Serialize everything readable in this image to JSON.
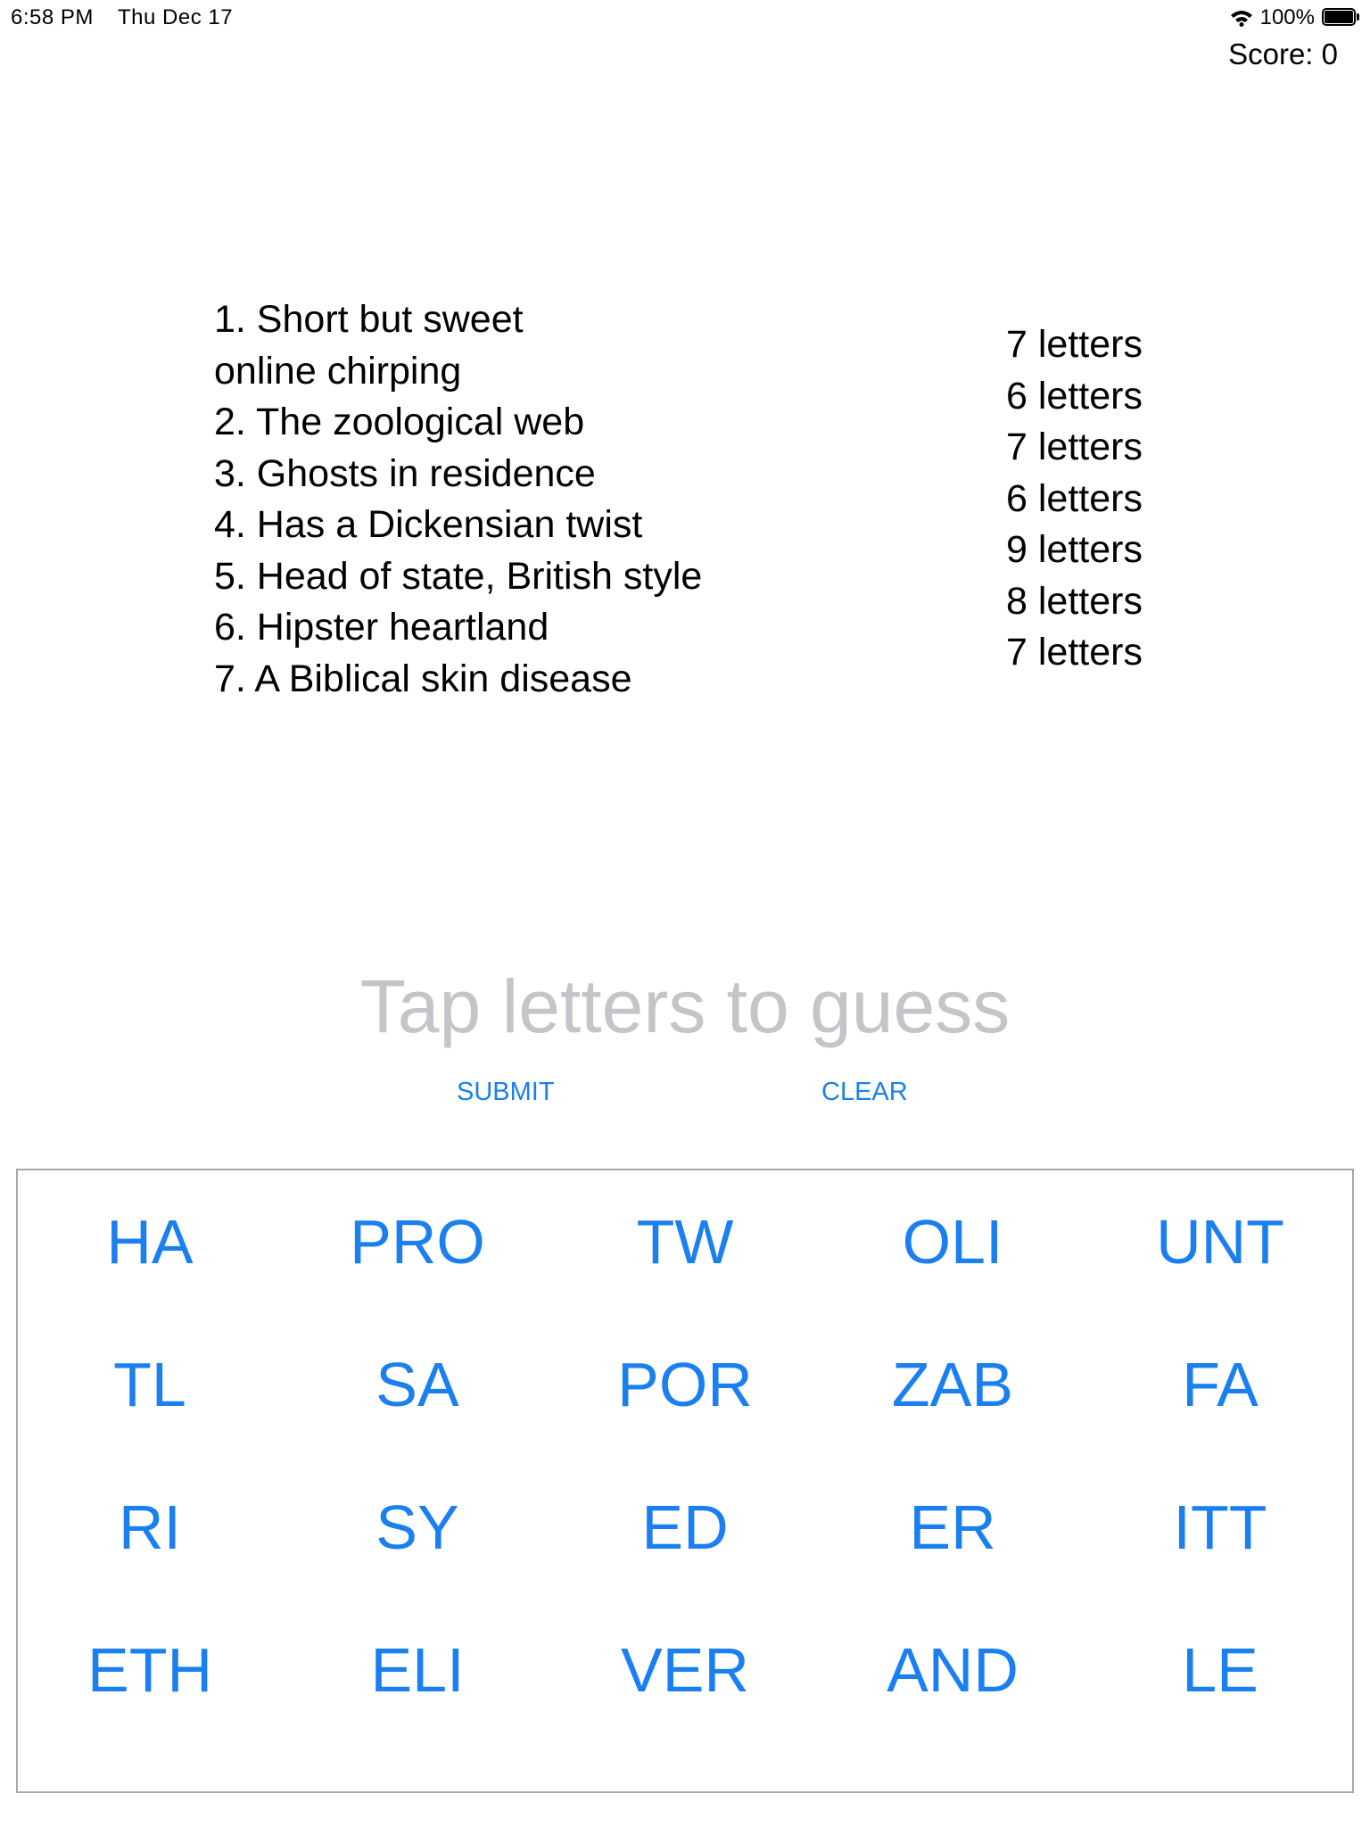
{
  "status_bar": {
    "time": "6:58 PM",
    "date": "Thu Dec 17",
    "battery_label": "100%",
    "battery_level": 1.0
  },
  "score_label": "Score: 0",
  "clues": [
    "1. Short but sweet",
    "online chirping",
    "2. The zoological web",
    "3. Ghosts in residence",
    "4. Has a Dickensian twist",
    "5. Head of state, British style",
    "6. Hipster heartland",
    "7. A Biblical skin disease"
  ],
  "lengths": [
    "7 letters",
    "6 letters",
    "7 letters",
    "6 letters",
    "9 letters",
    "8 letters",
    "7 letters"
  ],
  "guess_placeholder": "Tap letters to guess",
  "actions": {
    "submit_label": "SUBMIT",
    "clear_label": "CLEAR"
  },
  "tiles": [
    [
      "HA",
      "PRO",
      "TW",
      "OLI",
      "UNT"
    ],
    [
      "TL",
      "SA",
      "POR",
      "ZAB",
      "FA"
    ],
    [
      "RI",
      "SY",
      "ED",
      "ER",
      "ITT"
    ],
    [
      "ETH",
      "ELI",
      "VER",
      "AND",
      "LE"
    ]
  ],
  "colors": {
    "accent": "#1a7ff0",
    "placeholder": "#c5c5c9",
    "board_border": "#a8a8a8"
  }
}
